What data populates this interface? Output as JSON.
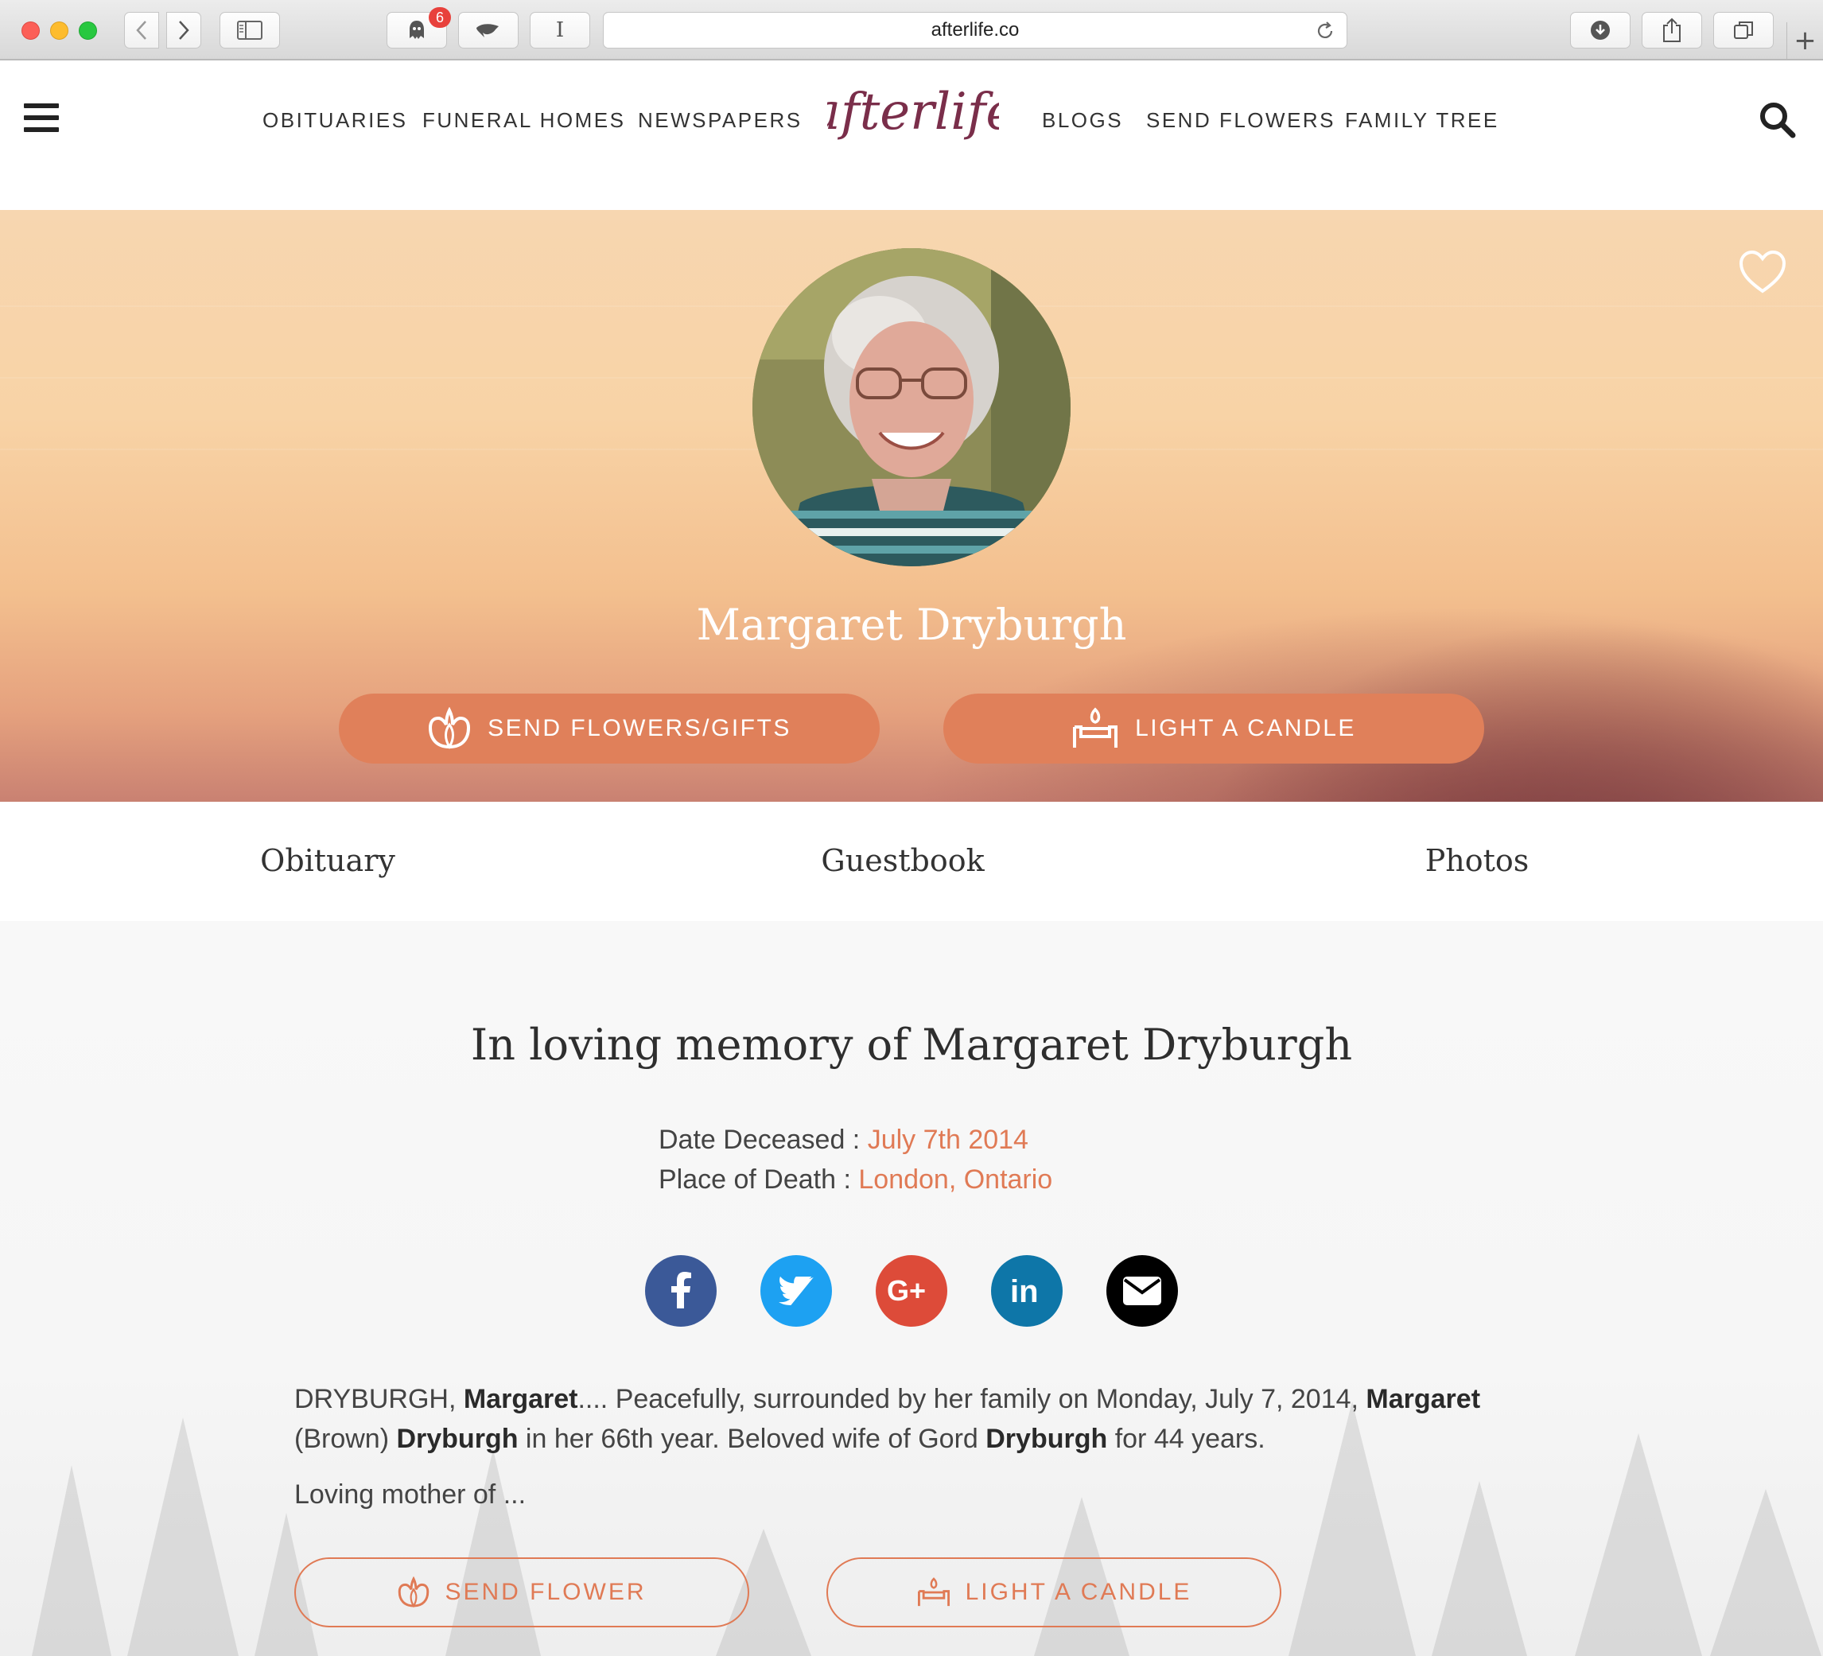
{
  "browser": {
    "url": "afterlife.co",
    "notification_count": "6",
    "reader_glyph": "I",
    "new_tab_glyph": "+"
  },
  "site": {
    "nav_left": [
      "OBITUARIES",
      "FUNERAL HOMES",
      "NEWSPAPERS"
    ],
    "nav_right": [
      "BLOGS",
      "SEND FLOWERS",
      "FAMILY TREE"
    ],
    "logo_text": "afterlife",
    "brand_color": "#7a2e4a",
    "accent_color": "#e0805a"
  },
  "hero": {
    "name": "Margaret Dryburgh",
    "send_flowers_label": "SEND FLOWERS/GIFTS",
    "light_candle_label": "LIGHT A CANDLE"
  },
  "tabs": [
    "Obituary",
    "Guestbook",
    "Photos"
  ],
  "memorial": {
    "title": "In loving memory of Margaret Dryburgh",
    "date_label": "Date Deceased : ",
    "date_value": "July 7th 2014",
    "place_label": "Place of Death : ",
    "place_value": "London, Ontario",
    "social": [
      {
        "name": "facebook",
        "glyph": "f",
        "color": "#3b5998"
      },
      {
        "name": "twitter",
        "glyph": "twitter-bird",
        "color": "#1da1f2"
      },
      {
        "name": "google-plus",
        "glyph": "G+",
        "color": "#dd4b39"
      },
      {
        "name": "linkedin",
        "glyph": "in",
        "color": "#0e76a8"
      },
      {
        "name": "email",
        "glyph": "envelope",
        "color": "#000000"
      }
    ],
    "bio_parts": {
      "p1a": "DRYBURGH, ",
      "p1b": "Margaret",
      "p1c": ".... Peacefully, surrounded by her family on Monday, July 7, 2014, ",
      "p1d": "Margaret",
      "p2a": "(Brown) ",
      "p2b": "Dryburgh",
      "p2c": " in her 66th year. Beloved wife of Gord ",
      "p2d": "Dryburgh",
      "p2e": " for 44 years."
    },
    "bio_more": "Loving mother of ...",
    "send_flower_label": "SEND FLOWER",
    "light_candle_label": "LIGHT A CANDLE"
  }
}
